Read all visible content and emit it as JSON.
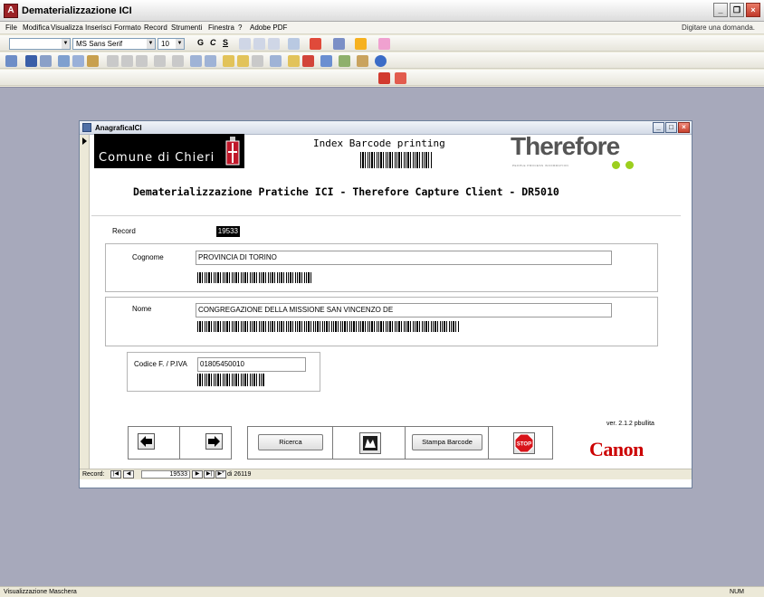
{
  "app": {
    "title": "Dematerializzazione ICI",
    "icon": "access-app-icon"
  },
  "menu": {
    "items": [
      "File",
      "Modifica",
      "Visualizza",
      "Inserisci",
      "Formato",
      "Record",
      "Strumenti",
      "Finestra",
      "?",
      "Adobe PDF"
    ],
    "help_box": "Digitare una domanda."
  },
  "toolbar": {
    "font_name": "MS Sans Serif",
    "font_size": "10",
    "bold": "G",
    "italic": "C",
    "underline": "S"
  },
  "form": {
    "window_title": "AnagraficaICI",
    "logo_comune": "Comune di Chieri",
    "index_title": "Index Barcode printing",
    "therefore_logo": "Therefore",
    "therefore_tagline": "PEOPLE  PROCESS  INFORMATION",
    "heading": "Dematerializzazione Pratiche ICI  - Therefore  Capture Client - DR5010",
    "record_label": "Record",
    "record_value": "19533",
    "cognome_label": "Cognome",
    "cognome_value": "PROVINCIA DI TORINO",
    "nome_label": "Nome",
    "nome_value": "CONGREGAZIONE DELLA MISSIONE SAN VINCENZO DE",
    "codice_label": "Codice F. / P.IVA",
    "codice_value": "01805450010",
    "ricerca_button": "Ricerca",
    "stampa_button": "Stampa Barcode",
    "version": "ver. 2.1.2 pbullita",
    "canon_logo": "Canon"
  },
  "record_nav": {
    "label": "Record:",
    "current": "19533",
    "of_text": "di 26119"
  },
  "status": {
    "left": "Visualizzazione Maschera",
    "right": "NUM"
  },
  "colors": {
    "workspace": "#a7a9bb",
    "canon_red": "#cc0000",
    "therefore_green": "#9ccf1e"
  }
}
